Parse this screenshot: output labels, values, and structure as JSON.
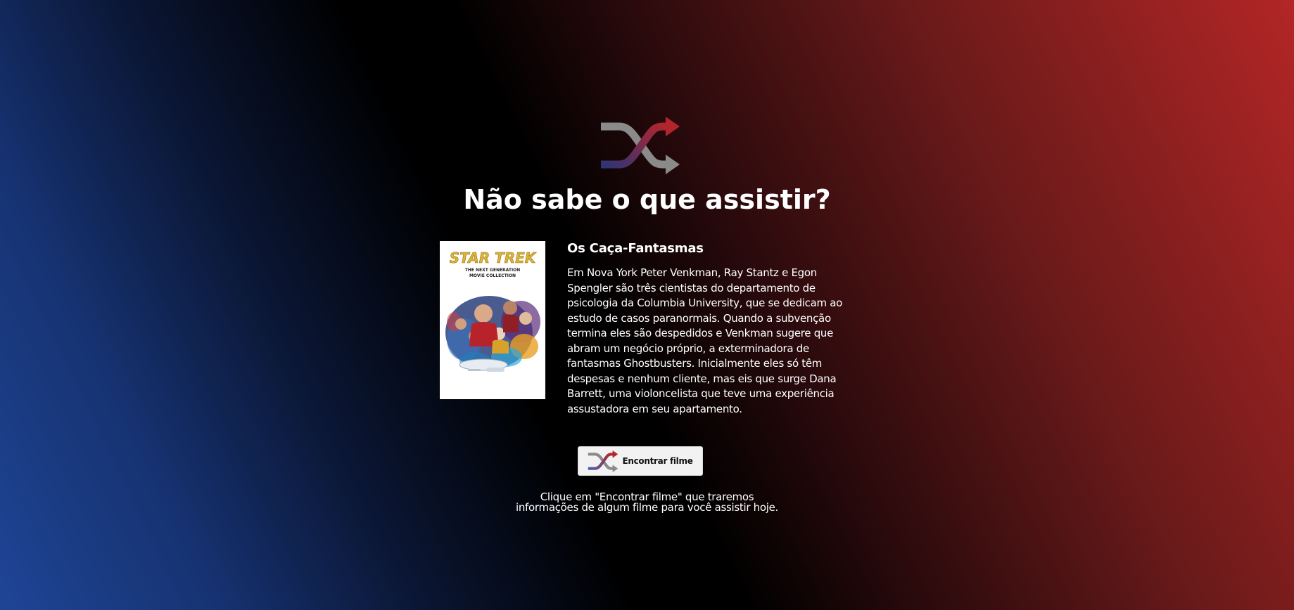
{
  "header": {
    "icon": "shuffle-icon",
    "title": "Não sabe o que assistir?"
  },
  "movie": {
    "poster": {
      "title": "STAR TREK",
      "subtitle_line1": "THE NEXT GENERATION",
      "subtitle_line2": "MOVIE COLLECTION"
    },
    "title": "Os Caça-Fantasmas",
    "overview": "Em Nova York Peter Venkman, Ray Stantz e Egon Spengler são três cientistas do departamento de psicologia da Columbia University, que se dedicam ao estudo de casos paranormais. Quando a subvenção termina eles são despedidos e Venkman sugere que abram um negócio próprio, a exterminadora de fantasmas Ghostbusters. Inicialmente eles só têm despesas e nenhum cliente, mas eis que surge Dana Barrett, uma violoncelista que teve uma experiência assustadora em seu apartamento."
  },
  "find_button": {
    "icon": "shuffle-icon",
    "label": "Encontrar filme"
  },
  "hint": {
    "line1": "Clique em \"Encontrar filme\" que traremos",
    "line2": "informações de algum filme para você assistir hoje."
  },
  "colors": {
    "background_blue": "#1f4596",
    "background_red": "#b32626",
    "icon_grey": "#8a8a8a",
    "icon_red": "#b3252d",
    "icon_blue": "#2f3475",
    "button_bg": "#f2f2f2"
  }
}
